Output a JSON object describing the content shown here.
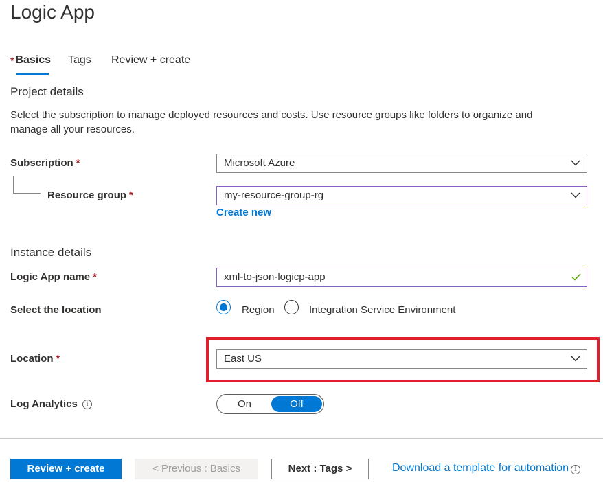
{
  "title": "Logic App",
  "tabs": [
    {
      "label": "Basics",
      "required_marker": "*"
    },
    {
      "label": "Tags"
    },
    {
      "label": "Review + create"
    }
  ],
  "project_details": {
    "heading": "Project details",
    "description": "Select the subscription to manage deployed resources and costs. Use resource groups like folders to organize and manage all your resources.",
    "subscription": {
      "label": "Subscription",
      "required": "*",
      "value": "Microsoft Azure"
    },
    "resource_group": {
      "label": "Resource group",
      "required": "*",
      "value": "my-resource-group-rg",
      "create_new": "Create new"
    }
  },
  "instance_details": {
    "heading": "Instance details",
    "app_name": {
      "label": "Logic App name",
      "required": "*",
      "value": "xml-to-json-logicp-app"
    },
    "select_location": {
      "label": "Select the location",
      "options": [
        "Region",
        "Integration Service Environment"
      ],
      "selected": "Region"
    },
    "location": {
      "label": "Location",
      "required": "*",
      "value": "East US"
    },
    "log_analytics": {
      "label": "Log Analytics",
      "info": "i",
      "on": "On",
      "off": "Off",
      "selected": "Off"
    }
  },
  "footer": {
    "review_create": "Review + create",
    "previous": "< Previous : Basics",
    "next": "Next : Tags >",
    "download": "Download a template for automation",
    "download_info": "i"
  },
  "colors": {
    "accent": "#0078d4",
    "required": "#a4262c",
    "highlight": "#e01e2d",
    "focus_border": "#8661c5",
    "valid_check": "#57a300"
  },
  "icons": {
    "dropdown": "chevron-down-icon",
    "valid": "checkmark-icon",
    "info": "info-icon"
  }
}
